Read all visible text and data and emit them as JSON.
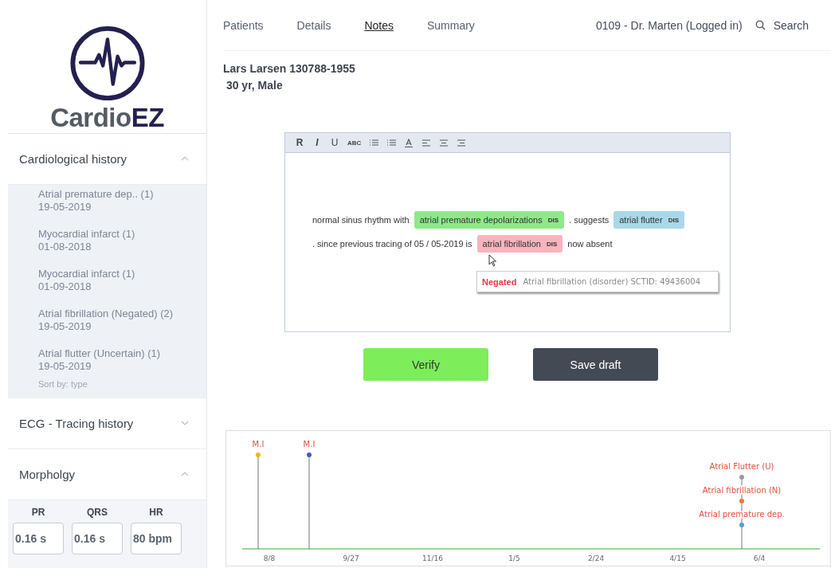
{
  "logo": {
    "text_main": "Cardio",
    "text_accent": "EZ"
  },
  "sidebar": {
    "sections": [
      {
        "title": "Cardiological history",
        "expanded": true,
        "items": [
          {
            "title": "Atrial premature dep.. (1)",
            "date": "19-05-2019"
          },
          {
            "title": "Myocardial infarct (1)",
            "date": "01-08-2018"
          },
          {
            "title": "Myocardial infarct (1)",
            "date": "01-09-2018"
          },
          {
            "title": "Atrial fibrillation (Negated) (2)",
            "date": "19-05-2019"
          },
          {
            "title": "Atrial flutter (Uncertain) (1)",
            "date": "19-05-2019"
          }
        ],
        "footer": "Sort by: type"
      },
      {
        "title": "ECG - Tracing history",
        "expanded": false
      },
      {
        "title": "Morpholgy",
        "expanded": true,
        "fields": [
          {
            "label": "PR",
            "value": "0.16 s"
          },
          {
            "label": "QRS",
            "value": "0.16 s"
          },
          {
            "label": "HR",
            "value": "80 bpm"
          }
        ]
      }
    ]
  },
  "nav": {
    "tabs": [
      {
        "label": "Patients",
        "selected": false
      },
      {
        "label": "Details",
        "selected": false
      },
      {
        "label": "Notes",
        "selected": true
      },
      {
        "label": "Summary",
        "selected": false
      }
    ],
    "user": "0109 - Dr. Marten (Logged in)",
    "search": "Search"
  },
  "patient": {
    "name": "Lars Larsen 130788-1955",
    "info": "30 yr, Male"
  },
  "editor": {
    "toolbar": [
      {
        "kind": "text",
        "label": "R"
      },
      {
        "kind": "text",
        "label": "I"
      },
      {
        "kind": "text",
        "label": "U"
      },
      {
        "kind": "text",
        "label": "ABC"
      },
      {
        "kind": "bullet-list"
      },
      {
        "kind": "numbered-list"
      },
      {
        "kind": "text-color"
      },
      {
        "kind": "align-left"
      },
      {
        "kind": "align-center"
      },
      {
        "kind": "align-right"
      }
    ],
    "lines": [
      [
        {
          "kind": "text",
          "text": "normal sinus rhythm with"
        },
        {
          "kind": "tag",
          "text": "atrial premature depolarizations",
          "badge": "DIS",
          "color": "#8fe88a"
        },
        {
          "kind": "text",
          "text": ". suggests"
        },
        {
          "kind": "tag",
          "text": "atrial flutter",
          "badge": "DIS",
          "color": "#a8d8ea"
        }
      ],
      [
        {
          "kind": "text",
          "text": ". since previous tracing of 05 / 05-2019 is"
        },
        {
          "kind": "tag",
          "text": "atrial fibrillation",
          "badge": "DIS",
          "color": "#f8b4bd"
        },
        {
          "kind": "text",
          "text": "now absent"
        }
      ]
    ],
    "tooltip": {
      "status": "Negated",
      "text": "Atrial fibrillation (disorder) SCTID: 49436004"
    }
  },
  "buttons": [
    {
      "kind": "primary",
      "label": "Verify"
    },
    {
      "kind": "secondary",
      "label": "Save draft"
    }
  ],
  "timeline": {
    "ticks": [
      "8/8",
      "9/27",
      "11/16",
      "1/5",
      "2/24",
      "4/15",
      "6/4"
    ],
    "columns": [
      {
        "events": [
          {
            "label": "M.I",
            "color": "#f5b800"
          }
        ]
      },
      {
        "events": [
          {
            "label": "M.I",
            "color": "#3b5fc0"
          }
        ]
      },
      {
        "events": [
          {
            "label": "Atrial Flutter (U)",
            "color": "#9a9a9a"
          },
          {
            "label": "Atrial fibrillation (N)",
            "color": "#f07a2a"
          },
          {
            "label": "Atrial premature dep.",
            "color": "#5b9bd5"
          }
        ]
      }
    ]
  }
}
